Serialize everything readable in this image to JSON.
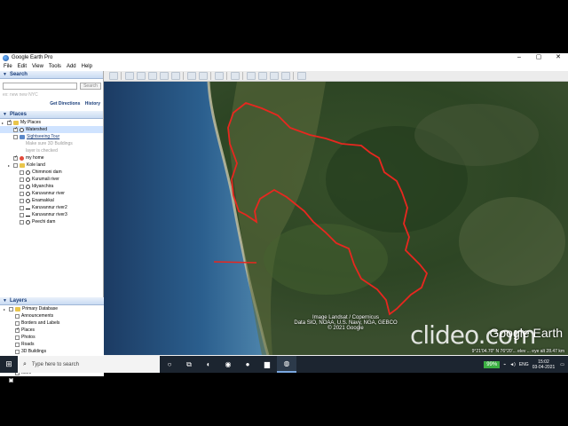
{
  "window": {
    "title": "Google Earth Pro",
    "controls": [
      "–",
      "▢",
      "✕"
    ]
  },
  "menu": [
    "File",
    "Edit",
    "View",
    "Tools",
    "Add",
    "Help"
  ],
  "search": {
    "header": "Search",
    "placeholder": "",
    "button": "Search",
    "hint": "ex: new new NYC",
    "link_directions": "Get Directions",
    "link_history": "History"
  },
  "places": {
    "header": "Places",
    "items": [
      {
        "label": "My Places",
        "depth": 0,
        "icon": "folder",
        "checked": true
      },
      {
        "label": "Watershed",
        "depth": 1,
        "icon": "poly",
        "checked": true,
        "selected": true
      },
      {
        "label": "Sightseeing Tour",
        "depth": 1,
        "icon": "tour",
        "checked": false,
        "link": true
      },
      {
        "label": "Make sure 3D Buildings",
        "depth": 3,
        "icon": "",
        "note": true
      },
      {
        "label": "layer is checked",
        "depth": 3,
        "icon": "",
        "note": true
      },
      {
        "label": "my home",
        "depth": 1,
        "icon": "pin",
        "checked": true
      },
      {
        "label": "Kole land",
        "depth": 1,
        "icon": "folder",
        "checked": false
      },
      {
        "label": "Chimmoni dam",
        "depth": 2,
        "icon": "poly",
        "checked": false
      },
      {
        "label": "Kurumali river",
        "depth": 2,
        "icon": "poly",
        "checked": false
      },
      {
        "label": "Idiyanchira",
        "depth": 2,
        "icon": "poly",
        "checked": false
      },
      {
        "label": "Karuvannur river",
        "depth": 2,
        "icon": "poly",
        "checked": false
      },
      {
        "label": "Enamakkal",
        "depth": 2,
        "icon": "poly",
        "checked": false
      },
      {
        "label": "Karuvannur river2",
        "depth": 2,
        "icon": "path",
        "checked": false
      },
      {
        "label": "Karuvannur river3",
        "depth": 2,
        "icon": "path",
        "checked": false
      },
      {
        "label": "Peechi dam",
        "depth": 2,
        "icon": "poly",
        "checked": false
      }
    ]
  },
  "layers": {
    "header": "Layers",
    "items": [
      {
        "label": "Primary Database",
        "depth": 0,
        "icon": "folder",
        "checked": false
      },
      {
        "label": "Announcements",
        "depth": 1,
        "icon": "",
        "checked": false
      },
      {
        "label": "Borders and Labels",
        "depth": 1,
        "icon": "",
        "checked": false
      },
      {
        "label": "Places",
        "depth": 1,
        "icon": "",
        "checked": true
      },
      {
        "label": "Photos",
        "depth": 1,
        "icon": "",
        "checked": false
      },
      {
        "label": "Roads",
        "depth": 1,
        "icon": "",
        "checked": false
      },
      {
        "label": "3D Buildings",
        "depth": 1,
        "icon": "",
        "checked": false
      },
      {
        "label": "Weather",
        "depth": 1,
        "icon": "",
        "checked": false
      },
      {
        "label": "Gallery",
        "depth": 1,
        "icon": "",
        "checked": false
      },
      {
        "label": "More",
        "depth": 1,
        "icon": "",
        "checked": false
      },
      {
        "label": "terrain",
        "depth": 0,
        "icon": "",
        "checked": true
      }
    ]
  },
  "map": {
    "attribution": [
      "Image Landsat / Copernicus",
      "Data SIO, NOAA, U.S. Navy, NGA, GEBCO",
      "© 2021 Google"
    ],
    "logo": "Google Earth",
    "status": "9°21'04.70\" N  76°20'...  elev  ...  eye alt  28.47 km",
    "watershed_color": "#e8271f"
  },
  "watermark": "clideo.com",
  "taskbar": {
    "search_placeholder": "Type here to search",
    "battery": "99%",
    "lang": "ENG",
    "time": "15:02",
    "date": "03-04-2021"
  }
}
